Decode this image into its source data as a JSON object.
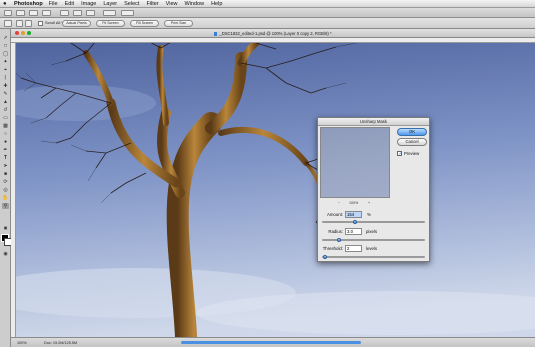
{
  "menubar": {
    "app_name": "Photoshop",
    "items": [
      "File",
      "Edit",
      "Image",
      "Layer",
      "Select",
      "Filter",
      "View",
      "Window",
      "Help"
    ]
  },
  "options_bar": {
    "checkbox_label": "Scroll All Windows",
    "buttons": [
      "Actual Pixels",
      "Fit Screen",
      "Fill Screen",
      "Print Size"
    ]
  },
  "document": {
    "title": "_DSC1832_edited-1.psd @ 100% (Layer 0 copy 2, RGB/8) *",
    "zoom": "100%",
    "doc_info": "Doc: 19.2M/125.5M"
  },
  "dialog": {
    "title": "Unsharp Mask",
    "ok_label": "OK",
    "cancel_label": "Cancel",
    "preview_label": "Preview",
    "preview_checked": true,
    "preview_zoom": "100%",
    "zoom_out_symbol": "−",
    "zoom_in_symbol": "+",
    "amount": {
      "label": "Amount:",
      "value": "154",
      "unit": "%",
      "slider_fraction": 0.31
    },
    "radius": {
      "label": "Radius:",
      "value": "3.0",
      "unit": "pixels",
      "slider_fraction": 0.15
    },
    "threshold": {
      "label": "Threshold:",
      "value": "2",
      "unit": "levels",
      "slider_fraction": 0.01
    }
  },
  "colors": {
    "accent": "#4e98ec",
    "sky_top": "#5a6ea6",
    "sky_bottom": "#c9d4e8",
    "trunk": "#a9782f"
  }
}
